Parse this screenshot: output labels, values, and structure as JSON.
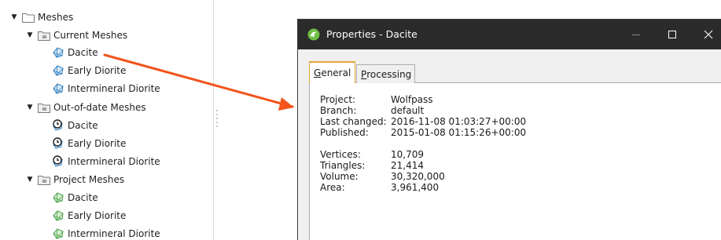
{
  "tree": {
    "root": {
      "label": "Meshes",
      "expanded": true
    },
    "groups": [
      {
        "label": "Current Meshes",
        "status": "current",
        "items": [
          "Dacite",
          "Early Diorite",
          "Intermineral Diorite"
        ]
      },
      {
        "label": "Out-of-date Meshes",
        "status": "out-of-date",
        "items": [
          "Dacite",
          "Early Diorite",
          "Intermineral Diorite"
        ]
      },
      {
        "label": "Project Meshes",
        "status": "project",
        "items": [
          "Dacite",
          "Early Diorite",
          "Intermineral Diorite"
        ]
      }
    ]
  },
  "dialog": {
    "title": "Properties - Dacite",
    "window_buttons": {
      "minimize": "—",
      "maximize": "☐",
      "close": "✕"
    },
    "tabs": [
      {
        "label": "General",
        "mnemonic": "G",
        "rest": "eneral",
        "active": true
      },
      {
        "label": "Processing",
        "mnemonic": "P",
        "rest": "rocessing",
        "active": false
      }
    ],
    "properties": [
      {
        "key": "Project:",
        "value": "Wolfpass"
      },
      {
        "key": "Branch:",
        "value": "default"
      },
      {
        "key": "Last changed:",
        "value": "2016-11-08 01:03:27+00:00"
      },
      {
        "key": "Published:",
        "value": "2015-01-08 01:15:26+00:00"
      },
      {
        "key": "Vertices:",
        "value": "10,709"
      },
      {
        "key": "Triangles:",
        "value": "21,414"
      },
      {
        "key": "Volume:",
        "value": "30,320,000"
      },
      {
        "key": "Area:",
        "value": "3,961,400"
      }
    ]
  },
  "colors": {
    "titlebar": "#2b2b2b",
    "arrow": "#f2541b",
    "tab_accent": "#e8a33a",
    "mesh_current": "#2f7fc0",
    "mesh_project": "#4aa14a"
  },
  "icons": {
    "folder": "folder-icon",
    "mesh_current": "mesh-icon",
    "mesh_outdated": "mesh-out-of-date-icon",
    "mesh_project": "mesh-project-icon",
    "app": "leapfrog-app-icon"
  }
}
